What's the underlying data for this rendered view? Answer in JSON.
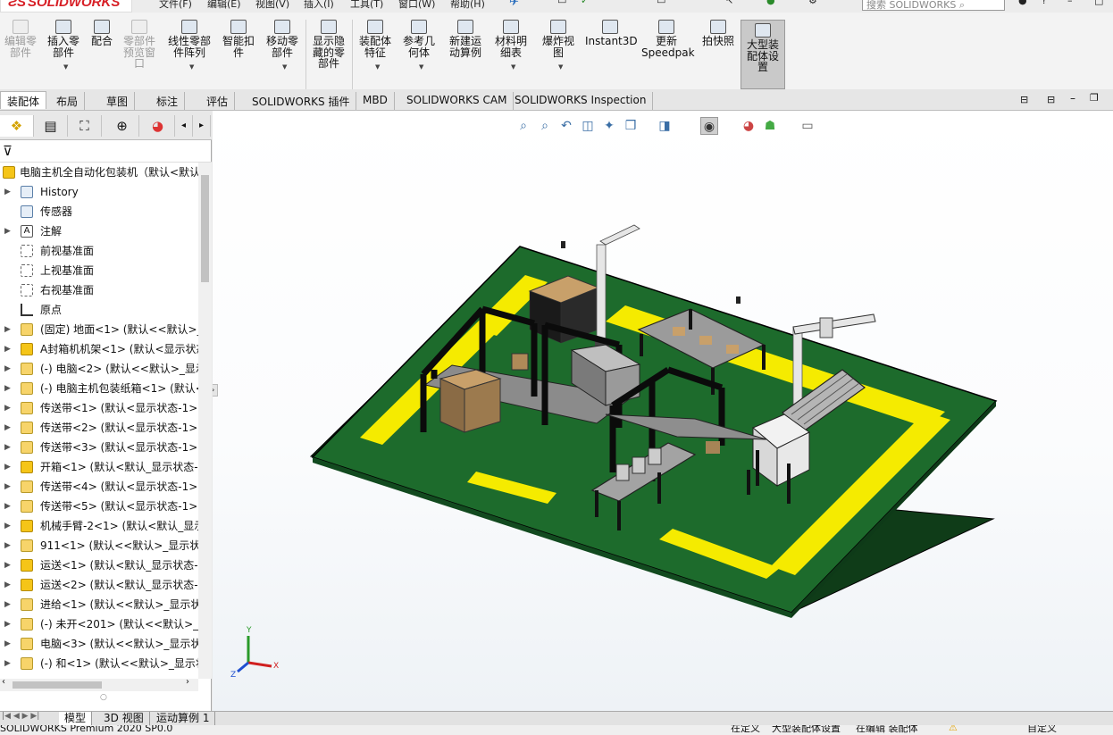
{
  "app": {
    "logo": "SOLIDWORKS",
    "menus": [
      "文件(F)",
      "编辑(E)",
      "视图(V)",
      "插入(I)",
      "工具(T)",
      "窗口(W)",
      "帮助(H)"
    ],
    "search_placeholder": "搜索 SOLIDWORKS"
  },
  "ribbon": {
    "buttons": [
      {
        "label": "编辑零\n部件",
        "icon": "edit-component-icon",
        "disabled": true
      },
      {
        "label": "插入零\n部件",
        "icon": "insert-component-icon",
        "disabled": false
      },
      {
        "label": "配合",
        "icon": "mate-paperclip-icon",
        "disabled": false
      },
      {
        "label": "零部件\n预览窗\n口",
        "icon": "component-preview-icon",
        "disabled": true
      },
      {
        "label": "线性零部\n件阵列",
        "icon": "linear-pattern-icon",
        "disabled": false
      },
      {
        "label": "智能扣\n件",
        "icon": "smart-fastener-icon",
        "disabled": false
      },
      {
        "label": "移动零\n部件",
        "icon": "move-component-icon",
        "disabled": false
      },
      {
        "label": "显示隐\n藏的零\n部件",
        "icon": "show-hidden-icon",
        "disabled": false
      },
      {
        "label": "装配体\n特征",
        "icon": "assembly-feature-icon",
        "disabled": false
      },
      {
        "label": "参考几\n何体",
        "icon": "reference-geometry-icon",
        "disabled": false
      },
      {
        "label": "新建运\n动算例",
        "icon": "motion-study-icon",
        "disabled": false
      },
      {
        "label": "材料明\n细表",
        "icon": "bom-icon",
        "disabled": false
      },
      {
        "label": "爆炸视\n图",
        "icon": "explode-view-icon",
        "disabled": false
      },
      {
        "label": "Instant3D",
        "icon": "instant3d-icon",
        "disabled": false
      },
      {
        "label": "更新\nSpeedpak",
        "icon": "speedpak-icon",
        "disabled": false
      },
      {
        "label": "拍快照",
        "icon": "camera-icon",
        "disabled": false
      },
      {
        "label": "大型装\n配体设\n置",
        "icon": "large-assembly-icon",
        "disabled": false,
        "active": true
      }
    ]
  },
  "tabs": [
    "装配体",
    "布局",
    "草图",
    "标注",
    "评估",
    "SOLIDWORKS 插件",
    "MBD",
    "SOLIDWORKS CAM",
    "SOLIDWORKS Inspection"
  ],
  "tree": {
    "root": "电脑主机全自动化包装机（默认<默认",
    "items": [
      {
        "label": "History",
        "icon": "hist",
        "expand": true
      },
      {
        "label": "传感器",
        "icon": "hist",
        "expand": false
      },
      {
        "label": "注解",
        "icon": "note",
        "expand": true
      },
      {
        "label": "前视基准面",
        "icon": "plane",
        "expand": false
      },
      {
        "label": "上视基准面",
        "icon": "plane",
        "expand": false
      },
      {
        "label": "右视基准面",
        "icon": "plane",
        "expand": false
      },
      {
        "label": "原点",
        "icon": "orig",
        "expand": false
      },
      {
        "label": "(固定) 地面<1> (默认<<默认>_",
        "icon": "part",
        "expand": true
      },
      {
        "label": "A封箱机机架<1> (默认<显示状态",
        "icon": "asm",
        "expand": true
      },
      {
        "label": "(-) 电脑<2> (默认<<默认>_显示",
        "icon": "part",
        "expand": true
      },
      {
        "label": "(-) 电脑主机包装纸箱<1> (默认<",
        "icon": "part",
        "expand": true
      },
      {
        "label": "传送带<1> (默认<显示状态-1>)",
        "icon": "part",
        "expand": true
      },
      {
        "label": "传送带<2> (默认<显示状态-1>)",
        "icon": "part",
        "expand": true
      },
      {
        "label": "传送带<3> (默认<显示状态-1>)",
        "icon": "part",
        "expand": true
      },
      {
        "label": "开箱<1> (默认<默认_显示状态-",
        "icon": "asm",
        "expand": true
      },
      {
        "label": "传送带<4> (默认<显示状态-1>)",
        "icon": "part",
        "expand": true
      },
      {
        "label": "传送带<5> (默认<显示状态-1>)",
        "icon": "part",
        "expand": true
      },
      {
        "label": "机械手臂-2<1> (默认<默认_显示",
        "icon": "asm",
        "expand": true
      },
      {
        "label": "911<1> (默认<<默认>_显示状态",
        "icon": "part",
        "expand": true
      },
      {
        "label": "运送<1> (默认<默认_显示状态-",
        "icon": "asm",
        "expand": true
      },
      {
        "label": "运送<2> (默认<默认_显示状态-",
        "icon": "asm",
        "expand": true
      },
      {
        "label": "进给<1> (默认<<默认>_显示状",
        "icon": "part",
        "expand": true
      },
      {
        "label": "(-) 未开<201> (默认<<默认>_显",
        "icon": "part",
        "expand": true
      },
      {
        "label": "电脑<3> (默认<<默认>_显示状",
        "icon": "part",
        "expand": true
      },
      {
        "label": "(-) 和<1> (默认<<默认>_显示状",
        "icon": "part",
        "expand": true
      }
    ]
  },
  "bottom_tabs": [
    "模型",
    "3D 视图",
    "运动算例 1"
  ],
  "status": {
    "left": "SOLIDWORKS Premium 2020 SP0.0",
    "custom": "在定义",
    "large_asm": "大型装配体设置",
    "editing": "在编辑 装配体",
    "right": "自定义"
  },
  "triad": {
    "x": "X",
    "y": "Y",
    "z": "Z"
  },
  "colors": {
    "floor": "#1d6b2c",
    "stripe": "#f5eb00",
    "frame": "#111111",
    "selected_tab_bg": "#ffffff"
  }
}
